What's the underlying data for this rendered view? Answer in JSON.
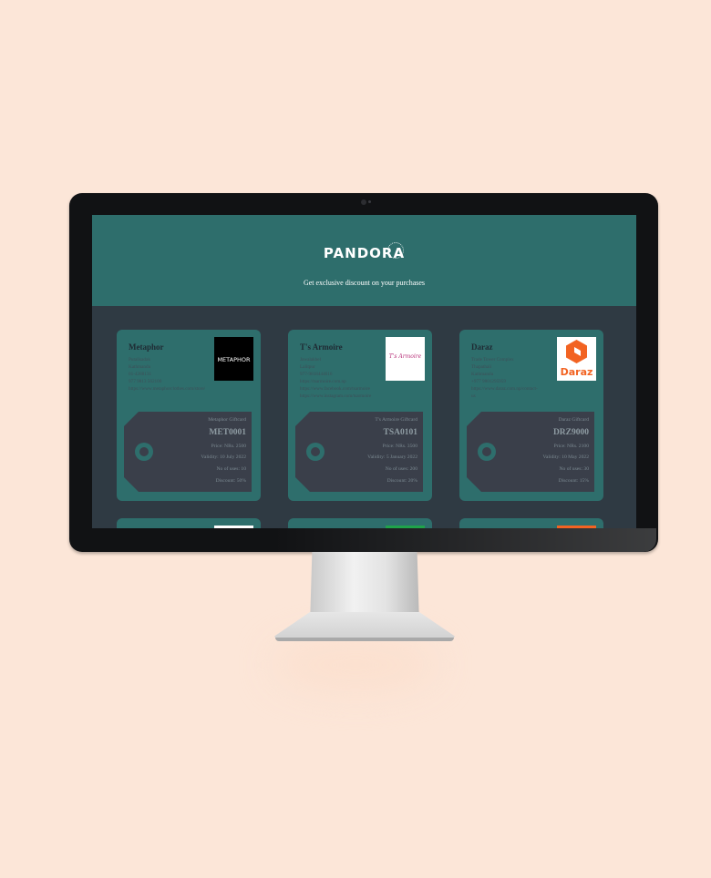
{
  "app": {
    "brand": "PANDORA",
    "brand_ring_text": "VOUCHERS",
    "tagline": "Get exclusive discount on your purchases"
  },
  "colors": {
    "background": "#fce6d8",
    "header": "#2e6e6c",
    "card": "#2e6e6c",
    "page": "#2f3a43",
    "tag": "#3a3f4a"
  },
  "cards": [
    {
      "name": "Metaphor",
      "info": [
        "Putalisadak",
        "Kathmandu",
        "01-4288131",
        "977 9813 562100",
        "https://www.metaphorclothes.com/store/"
      ],
      "logo_text": "METAPHOR",
      "giftcard": {
        "title": "Metaphor Giftcard",
        "code": "MET0001",
        "price": "Price: NRs. 2500",
        "validity": "Validity: 10 July 2022",
        "uses": "No of uses: 10",
        "discount": "Discount: 50%"
      }
    },
    {
      "name": "T's Armoire",
      "info": [
        "Jawalakhel",
        "Lalitpur",
        "977-9818444616",
        "https://tsarmoire.com.np",
        "https://www.facebook.com/tsarmoire",
        "https://www.instagram.com/tsarmoire"
      ],
      "logo_text": "T's Armoire",
      "giftcard": {
        "title": "T's Armoire Giftcard",
        "code": "TSA0101",
        "price": "Price: NRs. 3500",
        "validity": "Validity: 5 January 2022",
        "uses": "No of uses: 200",
        "discount": "Discount: 20%"
      }
    },
    {
      "name": "Daraz",
      "info": [
        "Trade Tower Complex",
        "Thapathali",
        "Kathmandu",
        "+977 9801295959",
        "https://www.daraz.com.np/contact-",
        "us"
      ],
      "logo_text": "Daraz",
      "giftcard": {
        "title": "Daraz Giftcard",
        "code": "DRZ9000",
        "price": "Price: NRs. 2100",
        "validity": "Validity: 10 May 2022",
        "uses": "No of uses: 30",
        "discount": "Discount: 15%"
      }
    }
  ]
}
